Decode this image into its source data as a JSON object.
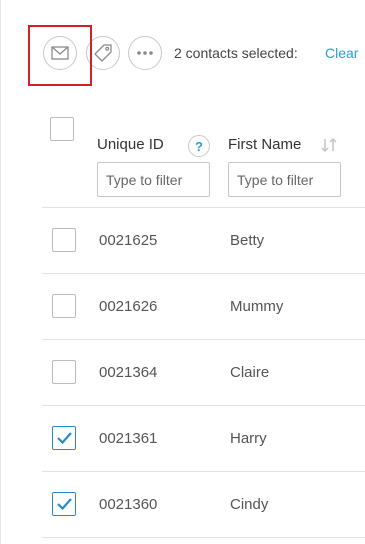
{
  "toolbar": {
    "email_icon": "envelope-icon",
    "tag_icon": "tag-icon",
    "more_icon": "ellipsis-icon",
    "selected_text": "2 contacts selected:",
    "clear_label": "Clear"
  },
  "table": {
    "columns": [
      {
        "label": "Unique ID",
        "placeholder": "Type to filter",
        "help": "?"
      },
      {
        "label": "First Name",
        "placeholder": "Type to filter"
      }
    ],
    "rows": [
      {
        "id": "0021625",
        "first_name": "Betty",
        "checked": false
      },
      {
        "id": "0021626",
        "first_name": "Mummy",
        "checked": false
      },
      {
        "id": "0021364",
        "first_name": "Claire",
        "checked": false
      },
      {
        "id": "0021361",
        "first_name": "Harry",
        "checked": true
      },
      {
        "id": "0021360",
        "first_name": "Cindy",
        "checked": true
      }
    ]
  },
  "colors": {
    "accent": "#2a9fd0",
    "checkbox_checked": "#2a8ac8",
    "highlight": "#d0202a"
  }
}
